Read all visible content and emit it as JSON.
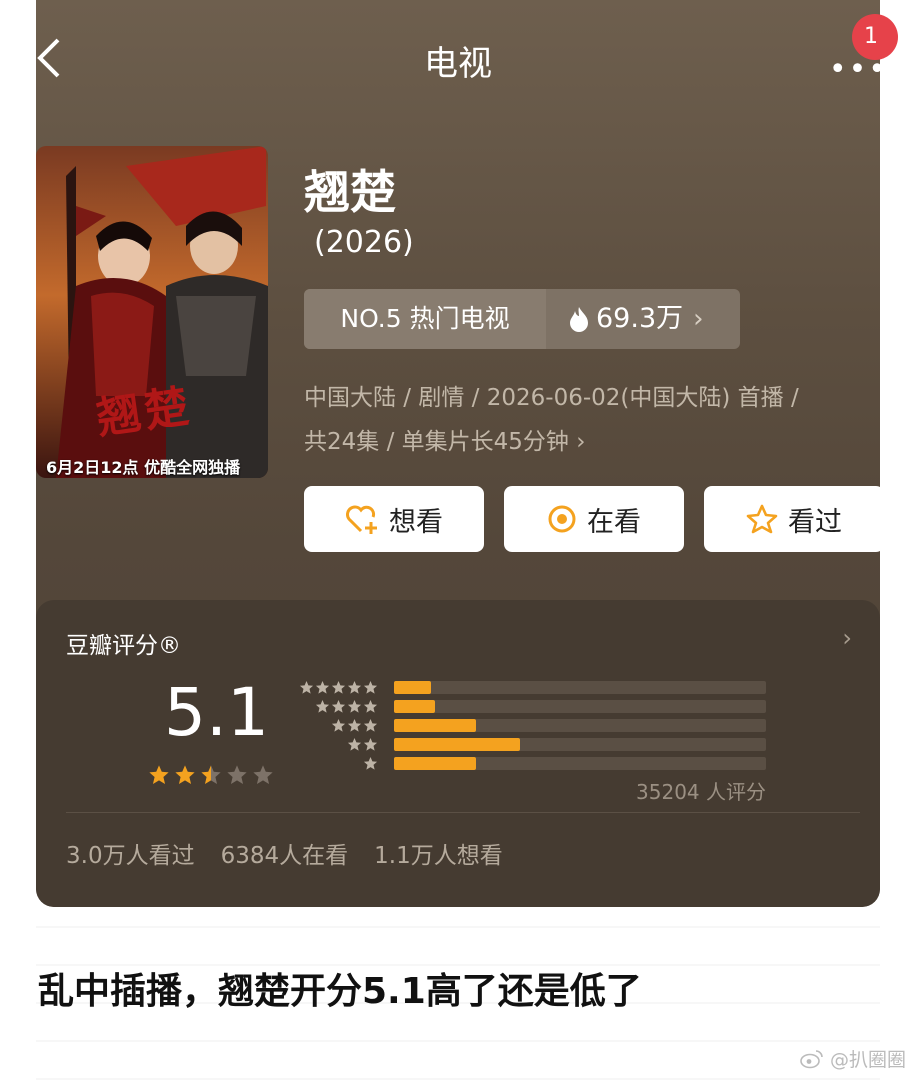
{
  "header": {
    "title": "电视",
    "notification_count": "1"
  },
  "show": {
    "title": "翘楚",
    "year": "(2026)",
    "rank_label": "NO.5 热门电视",
    "heat": "69.3万",
    "meta_line1": "中国大陆 / 剧情 / 2026-06-02(中国大陆) 首播 /",
    "meta_line2": "共24集 / 单集片长45分钟",
    "poster_caption": "6月2日12点 优酷全网独播",
    "poster_logo": "翘楚"
  },
  "actions": [
    {
      "label": "想看",
      "icon": "heart-plus-icon"
    },
    {
      "label": "在看",
      "icon": "watching-icon"
    },
    {
      "label": "看过",
      "icon": "star-icon"
    }
  ],
  "rating": {
    "title": "豆瓣评分®",
    "score": "5.1",
    "stars_value": 2.5,
    "distribution": [
      {
        "stars": 5,
        "fraction": 0.1
      },
      {
        "stars": 4,
        "fraction": 0.11
      },
      {
        "stars": 3,
        "fraction": 0.22
      },
      {
        "stars": 2,
        "fraction": 0.34
      },
      {
        "stars": 1,
        "fraction": 0.22
      }
    ],
    "count": "35204 人评分",
    "stats": [
      "3.0万人看过",
      "6384人在看",
      "1.1万人想看"
    ],
    "accent_color": "#f4a21f"
  },
  "caption": "乱中插播，翘楚开分5.1高了还是低了",
  "watermark": "@扒圈圈"
}
